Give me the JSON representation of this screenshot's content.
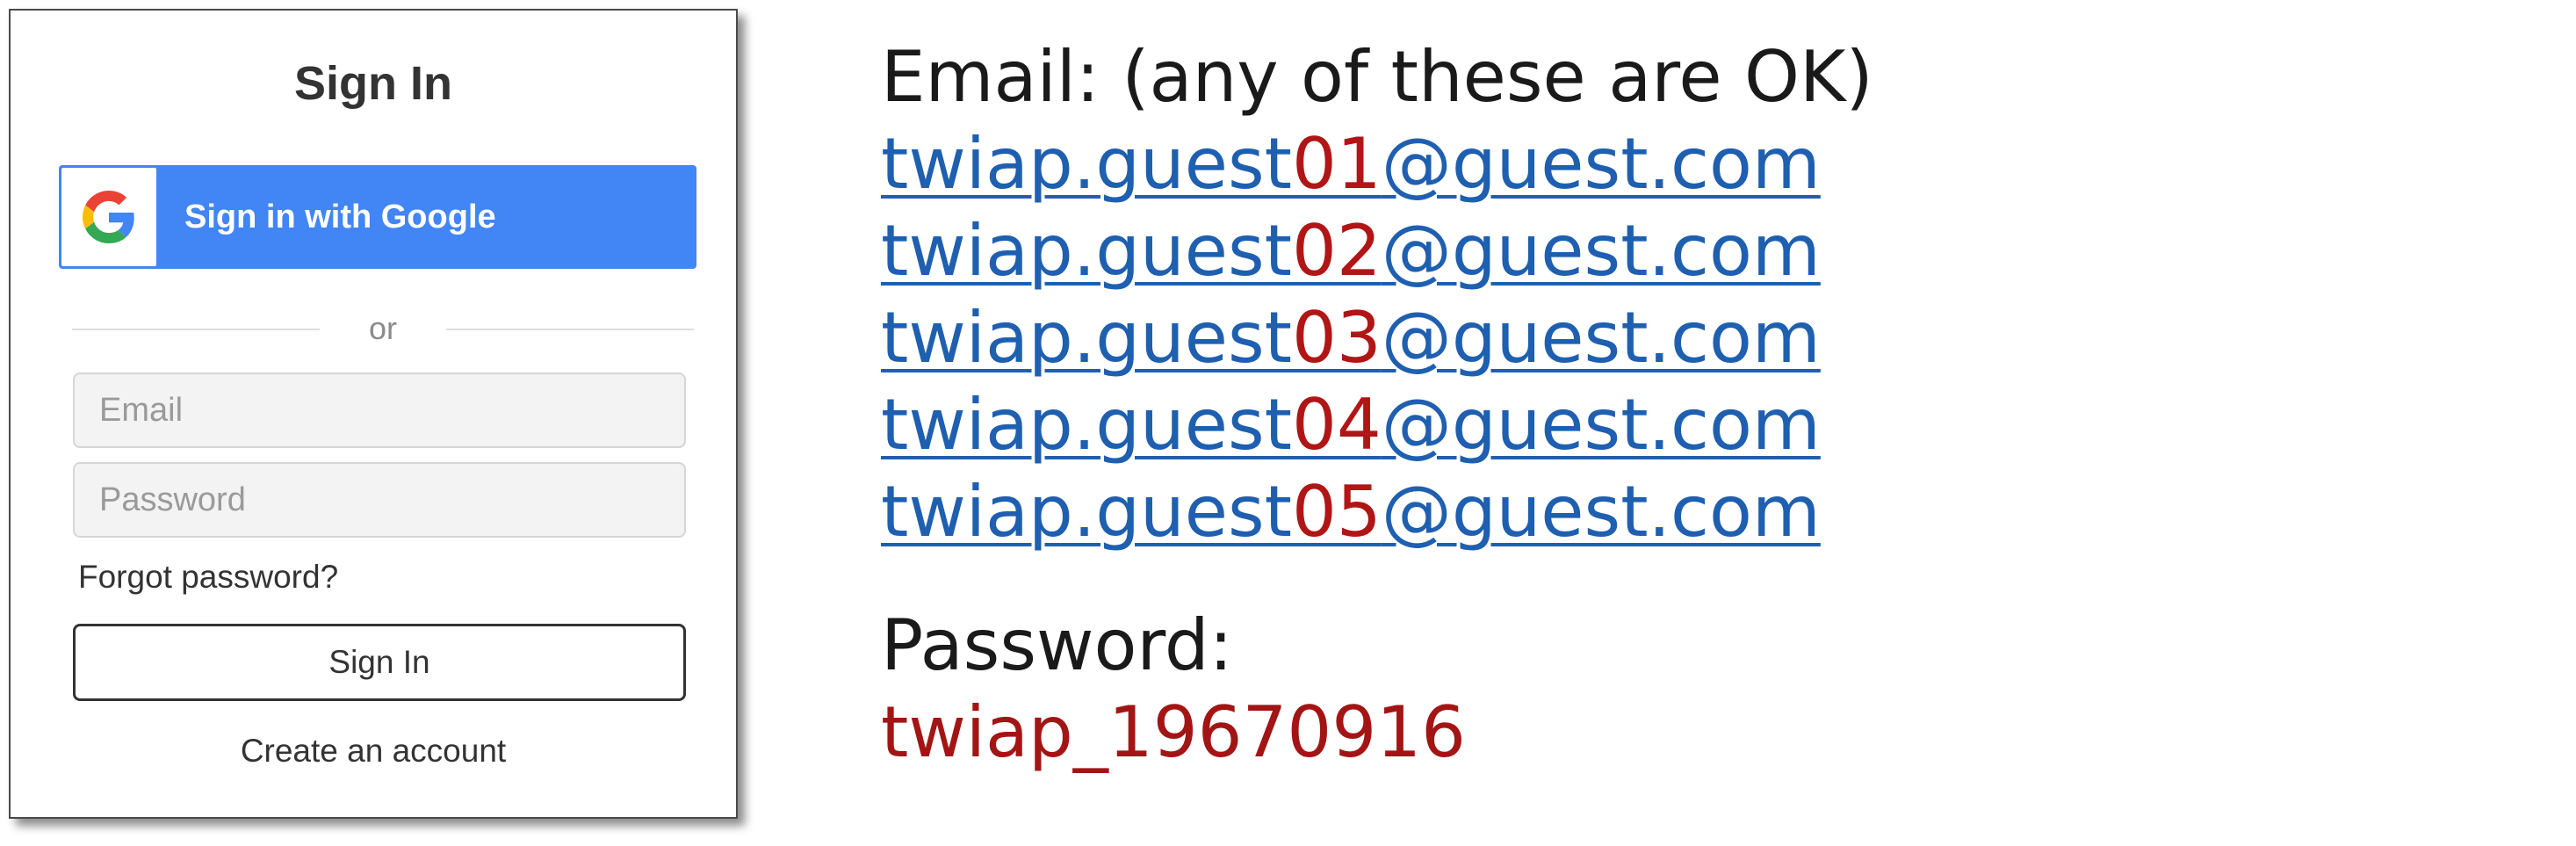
{
  "signin_card": {
    "title": "Sign In",
    "google_button_label": "Sign in with Google",
    "divider_text": "or",
    "email_placeholder": "Email",
    "password_placeholder": "Password",
    "forgot_password": "Forgot password?",
    "signin_button": "Sign In",
    "create_account": "Create an account",
    "google_colors": {
      "blue": "#4285F4",
      "red": "#EA4335",
      "yellow": "#FBBC05",
      "green": "#34A853"
    }
  },
  "credentials": {
    "email_heading": "Email: (any of these are OK)",
    "emails": [
      {
        "prefix": "twiap.guest",
        "number": "01",
        "suffix": "@guest.com"
      },
      {
        "prefix": "twiap.guest",
        "number": "02",
        "suffix": "@guest.com"
      },
      {
        "prefix": "twiap.guest",
        "number": "03",
        "suffix": "@guest.com"
      },
      {
        "prefix": "twiap.guest",
        "number": "04",
        "suffix": "@guest.com"
      },
      {
        "prefix": "twiap.guest",
        "number": "05",
        "suffix": "@guest.com"
      }
    ],
    "password_heading": "Password:",
    "password_value": "twiap_19670916"
  },
  "colors": {
    "link": "#1f5fb0",
    "highlight_red": "#b01616",
    "google_button": "#4285f4"
  }
}
